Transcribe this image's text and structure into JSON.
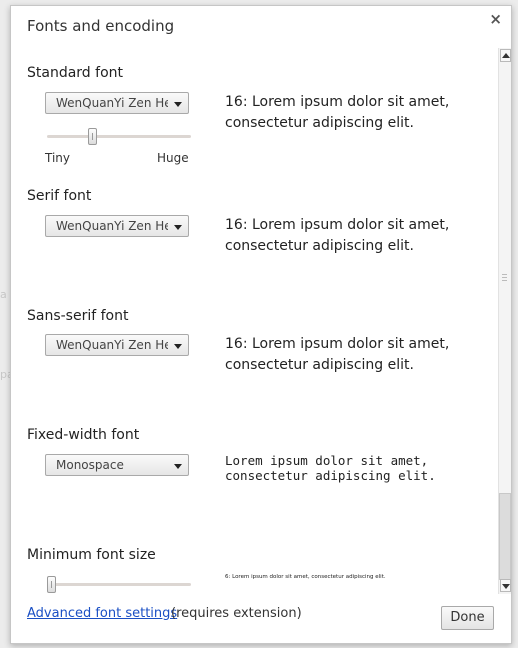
{
  "backdrop": {
    "fragment_1": "a",
    "fragment_2": "pa"
  },
  "dialog": {
    "title": "Fonts and encoding",
    "close_label": "×"
  },
  "sections": {
    "standard": {
      "title": "Standard font",
      "select_value": "WenQuanYi Zen Hei",
      "sample": "16: Lorem ipsum dolor sit amet, consectetur adipiscing elit.",
      "slider": {
        "min_label": "Tiny",
        "max_label": "Huge",
        "level": 0.3
      }
    },
    "serif": {
      "title": "Serif font",
      "select_value": "WenQuanYi Zen Hei",
      "sample": "16: Lorem ipsum dolor sit amet, consectetur adipiscing elit."
    },
    "sans_serif": {
      "title": "Sans-serif font",
      "select_value": "WenQuanYi Zen Hei",
      "sample": "16: Lorem ipsum dolor sit amet, consectetur adipiscing elit."
    },
    "fixed_width": {
      "title": "Fixed-width font",
      "select_value": "Monospace",
      "sample": "Lorem ipsum dolor sit amet, consectetur adipiscing elit."
    },
    "minimum": {
      "title": "Minimum font size",
      "sample": "6: Lorem ipsum dolor sit amet, consectetur adipiscing elit.",
      "slider": {
        "level": 0.0
      }
    }
  },
  "footer": {
    "advanced_link": "Advanced font settings",
    "advanced_note": "(requires extension)",
    "done_label": "Done"
  },
  "icons": {
    "close": "close-icon",
    "dropdown": "chevron-down-icon",
    "scroll_up": "arrow-up-icon",
    "scroll_down": "arrow-down-icon"
  },
  "colors": {
    "link": "#1a4fc4",
    "dialog_bg": "#ffffff",
    "backdrop": "#ececec"
  }
}
